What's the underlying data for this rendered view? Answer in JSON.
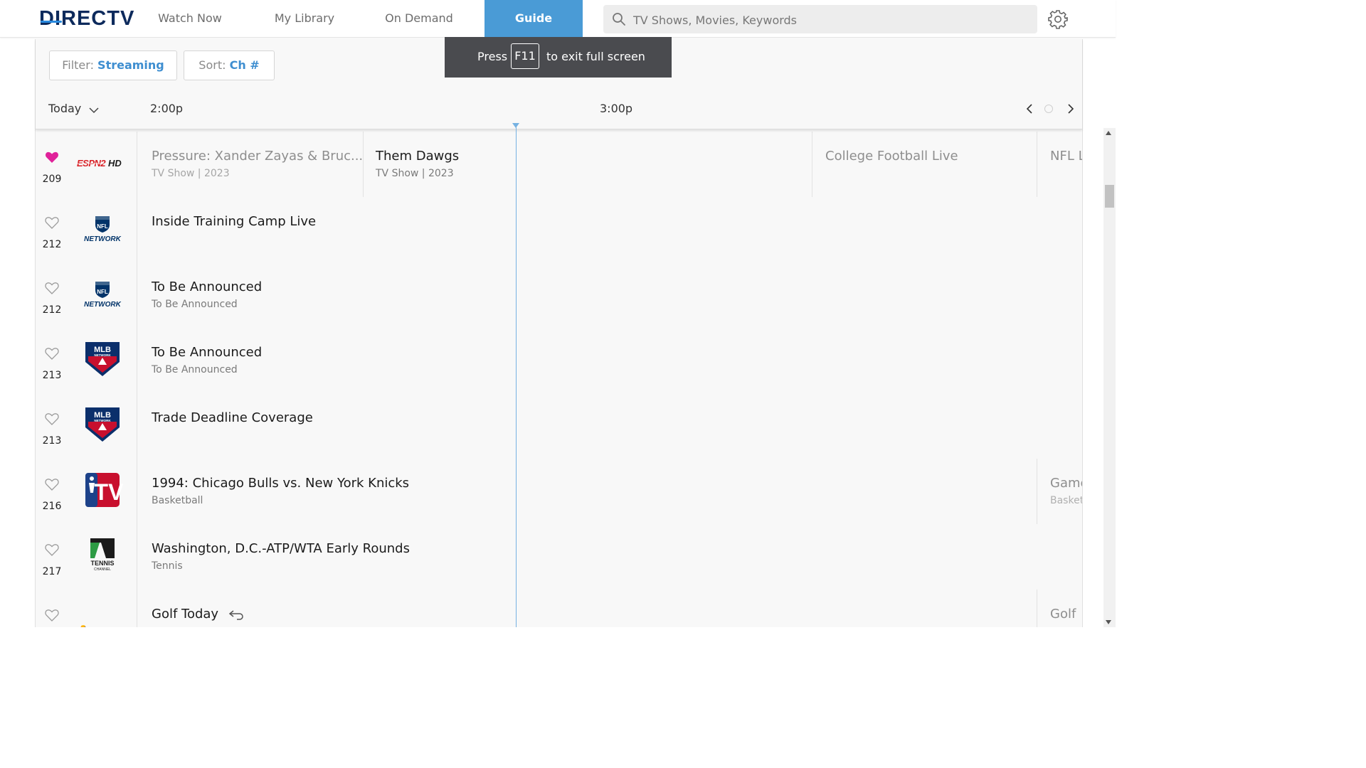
{
  "app": {
    "logo": "DIRECTV"
  },
  "nav": {
    "items": [
      {
        "label": "Watch Now",
        "active": false
      },
      {
        "label": "My Library",
        "active": false
      },
      {
        "label": "On Demand",
        "active": false
      },
      {
        "label": "Guide",
        "active": true
      }
    ]
  },
  "search": {
    "placeholder": "TV Shows, Movies, Keywords",
    "value": ""
  },
  "icons": {
    "search": "search-icon",
    "settings": "gear-icon",
    "favorite": "heart-icon",
    "record": "restart-icon"
  },
  "colors": {
    "accent": "#4a9bd6",
    "filter_value": "#3e8ed0",
    "favorite": "#e0229a",
    "now_line": "#76b2e2"
  },
  "toast": {
    "before": "Press",
    "key": "F11",
    "after": "to exit full screen"
  },
  "guide": {
    "filter": {
      "label": "Filter:",
      "value": "Streaming"
    },
    "sort": {
      "label": "Sort:",
      "value": "Ch #"
    },
    "day": "Today",
    "times": [
      "2:00p",
      "3:00p"
    ]
  },
  "channels": [
    {
      "number": "209",
      "logo": "ESPN2HD",
      "favorite": true,
      "programs": [
        {
          "title": "Pressure: Xander Zayas & Bruc...",
          "sub": "TV Show | 2023",
          "state": "past"
        },
        {
          "title": "Them Dawgs",
          "sub": "TV Show | 2023",
          "state": "current"
        },
        {
          "title": "",
          "sub": "",
          "state": "current"
        },
        {
          "title": "College Football Live",
          "sub": "",
          "state": "future"
        },
        {
          "title": "NFL L",
          "sub": "",
          "state": "future"
        }
      ]
    },
    {
      "number": "212",
      "logo": "NFL NETWORK",
      "favorite": false,
      "programs": [
        {
          "title": "Inside Training Camp Live",
          "sub": "",
          "state": "current"
        }
      ]
    },
    {
      "number": "212",
      "logo": "NFL NETWORK",
      "favorite": false,
      "programs": [
        {
          "title": "To Be Announced",
          "sub": "To Be Announced",
          "state": "current"
        }
      ]
    },
    {
      "number": "213",
      "logo": "MLB NETWORK",
      "favorite": false,
      "programs": [
        {
          "title": "To Be Announced",
          "sub": "To Be Announced",
          "state": "current"
        }
      ]
    },
    {
      "number": "213",
      "logo": "MLB NETWORK",
      "favorite": false,
      "programs": [
        {
          "title": "Trade Deadline Coverage",
          "sub": "",
          "state": "current"
        }
      ]
    },
    {
      "number": "216",
      "logo": "NBA TV",
      "favorite": false,
      "programs": [
        {
          "title": "1994: Chicago Bulls vs. New York Knicks",
          "sub": "Basketball",
          "state": "current"
        },
        {
          "title": "Game",
          "sub": "Basket",
          "state": "future"
        }
      ]
    },
    {
      "number": "217",
      "logo": "TENNIS CHANNEL",
      "favorite": false,
      "programs": [
        {
          "title": "Washington, D.C.-ATP/WTA Early Rounds",
          "sub": "Tennis",
          "state": "current"
        }
      ]
    },
    {
      "number": "",
      "logo": "GOLF",
      "favorite": false,
      "programs": [
        {
          "title": "Golf Today",
          "sub": "",
          "state": "current"
        },
        {
          "title": "Golf",
          "sub": "",
          "state": "future"
        }
      ]
    }
  ]
}
